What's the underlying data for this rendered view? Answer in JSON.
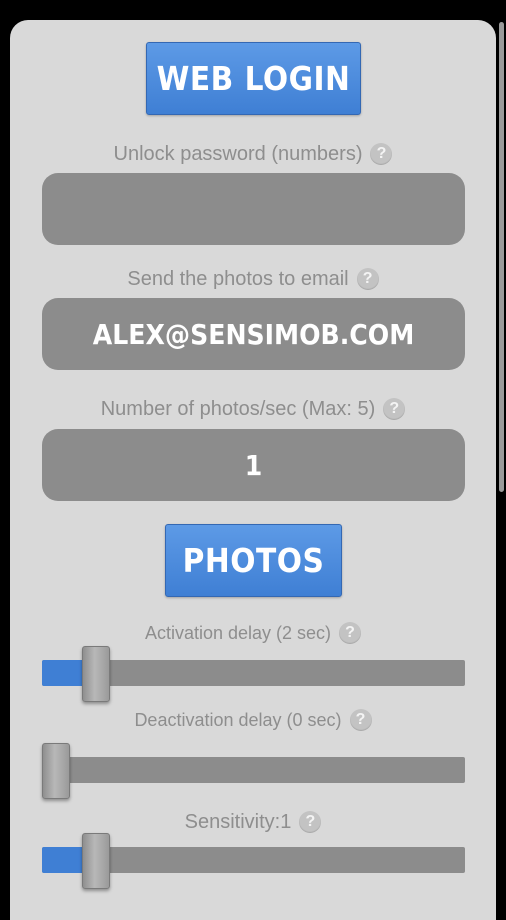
{
  "web_login": {
    "label": "WEB LOGIN"
  },
  "unlock_password": {
    "label": "Unlock password (numbers)",
    "value": ""
  },
  "email": {
    "label": "Send the photos to email",
    "value": "ALEX@SENSIMOB.COM"
  },
  "photos_per_sec": {
    "label": "Number of photos/sec (Max: 5)",
    "value": "1"
  },
  "photos_button": {
    "label": "PHOTOS"
  },
  "help_glyph": "?",
  "sliders": {
    "activation": {
      "label": "Activation delay (2 sec)",
      "level": 0.08
    },
    "deactivation": {
      "label": "Deactivation delay (0 sec)",
      "level": 0
    },
    "sensitivity": {
      "label": "Sensitivity:1",
      "level": 0.08
    }
  },
  "colors": {
    "accent": "#4a8ae0",
    "panel": "#d9d9d9",
    "field": "#8c8c8c"
  }
}
